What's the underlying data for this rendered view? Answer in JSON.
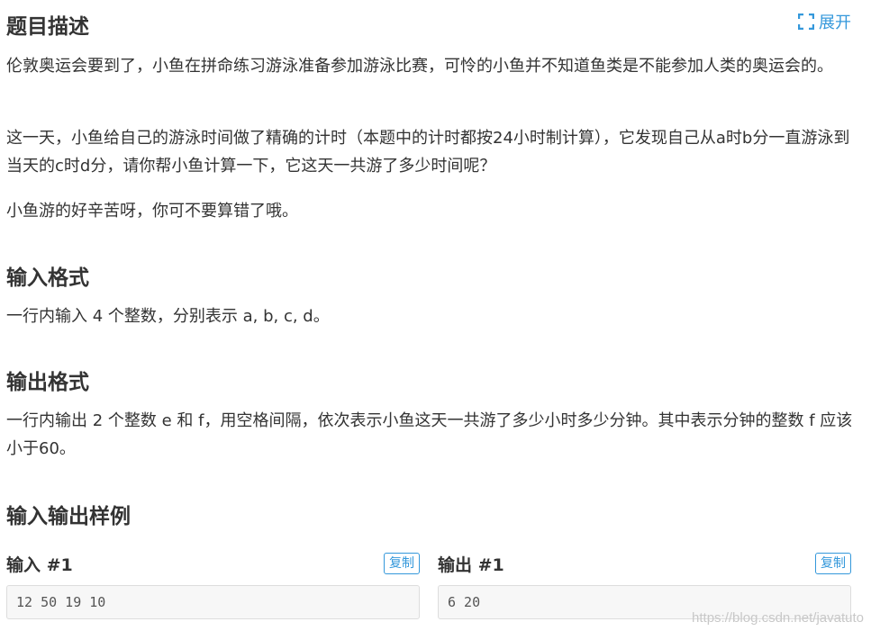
{
  "description": {
    "title": "题目描述",
    "expand_label": "展开",
    "paragraphs": [
      "伦敦奥运会要到了，小鱼在拼命练习游泳准备参加游泳比赛，可怜的小鱼并不知道鱼类是不能参加人类的奥运会的。",
      "这一天，小鱼给自己的游泳时间做了精确的计时（本题中的计时都按24小时制计算），它发现自己从a时b分一直游泳到当天的c时d分，请你帮小鱼计算一下，它这天一共游了多少时间呢？",
      "小鱼游的好辛苦呀，你可不要算错了哦。"
    ]
  },
  "input_format": {
    "title": "输入格式",
    "text": "一行内输入 4 个整数，分别表示 a, b, c, d。"
  },
  "output_format": {
    "title": "输出格式",
    "text": "一行内输出 2 个整数 e 和 f，用空格间隔，依次表示小鱼这天一共游了多少小时多少分钟。其中表示分钟的整数 f 应该小于60。"
  },
  "samples": {
    "title": "输入输出样例",
    "input": {
      "label": "输入 #1",
      "copy_label": "复制",
      "value": "12 50 19 10"
    },
    "output": {
      "label": "输出 #1",
      "copy_label": "复制",
      "value": "6 20"
    }
  },
  "watermark": "https://blog.csdn.net/javatuto",
  "colors": {
    "accent": "#3498db",
    "text": "#333333",
    "code_bg": "#f7f7f7"
  }
}
